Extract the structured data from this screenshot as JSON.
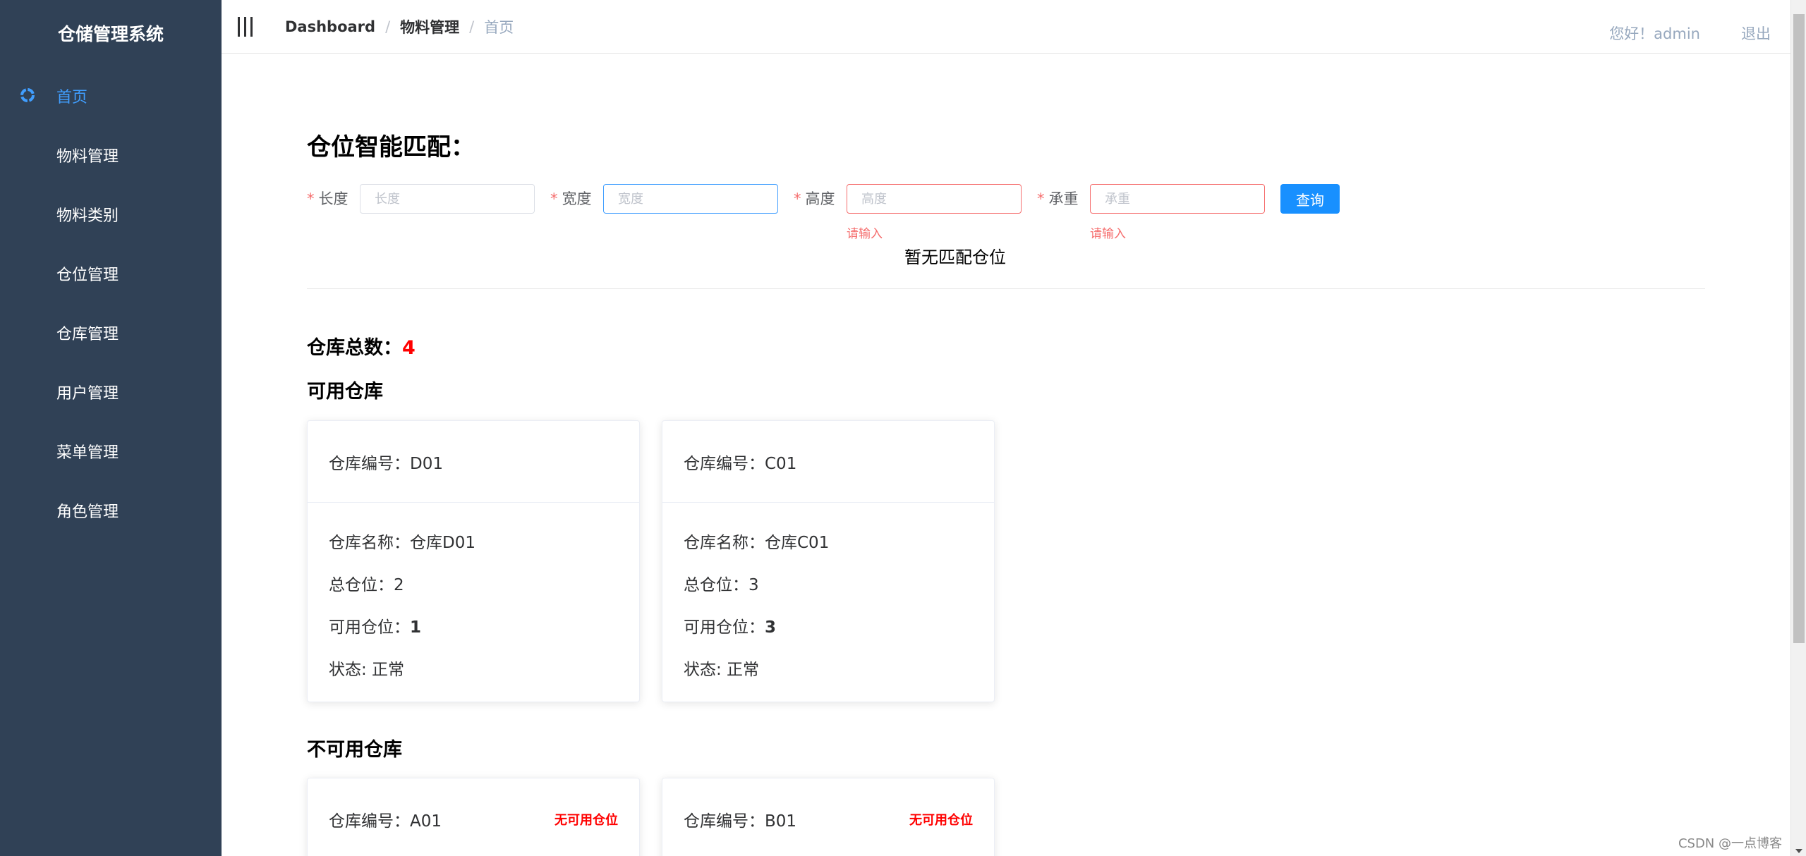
{
  "sidebar": {
    "brand": "仓储管理系统",
    "items": [
      {
        "label": "首页",
        "icon": "home-icon",
        "active": true
      },
      {
        "label": "物料管理",
        "icon": "grid-icon"
      },
      {
        "label": "物料类别",
        "icon": "grid-icon"
      },
      {
        "label": "仓位管理",
        "icon": "grid-icon"
      },
      {
        "label": "仓库管理",
        "icon": "grid-icon"
      },
      {
        "label": "用户管理",
        "icon": "grid-icon"
      },
      {
        "label": "菜单管理",
        "icon": "grid-icon"
      },
      {
        "label": "角色管理",
        "icon": "grid-icon"
      }
    ]
  },
  "header": {
    "breadcrumb": [
      "Dashboard",
      "物料管理",
      "首页"
    ],
    "breadcrumb_sep": "/",
    "greeting": "您好！admin",
    "logout": "退出"
  },
  "match": {
    "title": "仓位智能匹配：",
    "required_mark": "*",
    "fields": [
      {
        "label": "长度",
        "placeholder": "长度",
        "value": "",
        "state": "normal",
        "error": ""
      },
      {
        "label": "宽度",
        "placeholder": "宽度",
        "value": "",
        "state": "focus",
        "error": ""
      },
      {
        "label": "高度",
        "placeholder": "高度",
        "value": "",
        "state": "error",
        "error": "请输入"
      },
      {
        "label": "承重",
        "placeholder": "承重",
        "value": "",
        "state": "error",
        "error": "请输入"
      }
    ],
    "query_button": "查询",
    "empty_text": "暂无匹配仓位"
  },
  "stats": {
    "total_label": "仓库总数：",
    "total_value": "4",
    "available_heading": "可用仓库",
    "unavailable_heading": "不可用仓库"
  },
  "available": [
    {
      "code_label": "仓库编号：D01",
      "name": "仓库名称：仓库D01",
      "total": "总仓位：2",
      "free_label": "可用仓位：",
      "free_value": "1",
      "status": "状态: 正常"
    },
    {
      "code_label": "仓库编号：C01",
      "name": "仓库名称：仓库C01",
      "total": "总仓位：3",
      "free_label": "可用仓位：",
      "free_value": "3",
      "status": "状态: 正常"
    }
  ],
  "unavailable": [
    {
      "code_label": "仓库编号：A01",
      "badge": "无可用仓位"
    },
    {
      "code_label": "仓库编号：B01",
      "badge": "无可用仓位"
    }
  ],
  "watermark": "CSDN @一点博客",
  "colors": {
    "sidebar_bg": "#304156",
    "accent": "#409eff",
    "danger": "#f56c6c",
    "button": "#1890ff"
  }
}
